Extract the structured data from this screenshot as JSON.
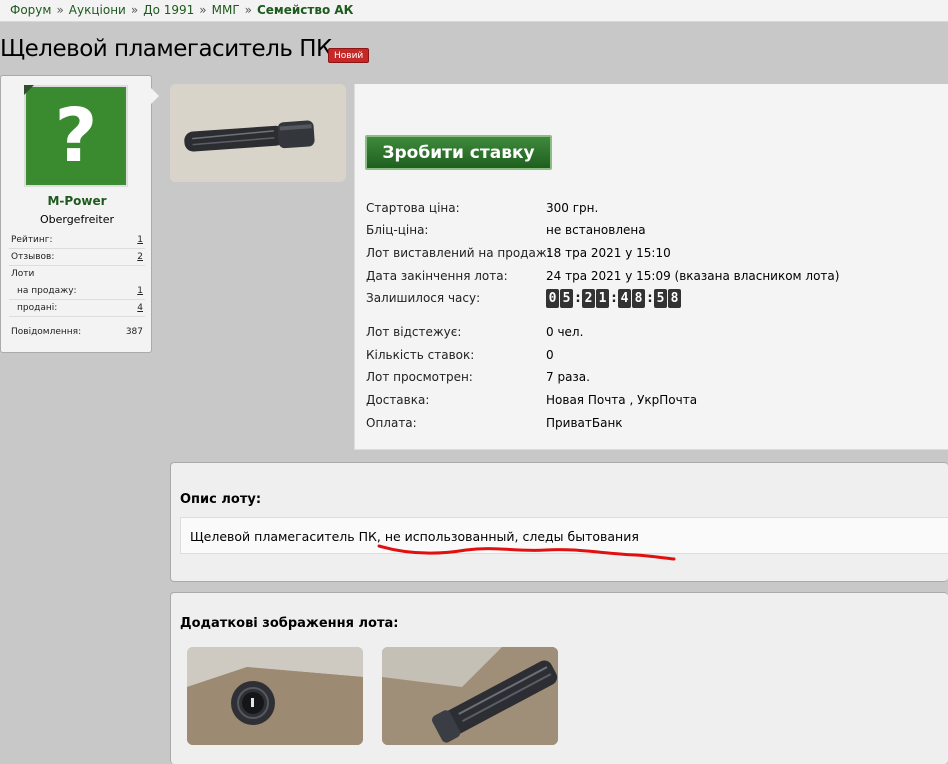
{
  "breadcrumb": {
    "items": [
      "Форум",
      "Аукціони",
      "До 1991",
      "ММГ"
    ],
    "separator": "»",
    "current": "Семейство АК"
  },
  "page": {
    "title": "Щелевой пламегаситель ПК",
    "badge": "Новий"
  },
  "user": {
    "avatar_icon": "question-mark-icon",
    "avatar_glyph": "?",
    "name": "M-Power",
    "rank": "Obergefreiter",
    "stats": {
      "rating_label": "Рейтинг:",
      "rating_value": "1",
      "reviews_label": "Отзывов:",
      "reviews_value": "2",
      "lots_label": "Лоти",
      "for_sale_label": "на продажу:",
      "for_sale_value": "1",
      "sold_label": "продані:",
      "sold_value": "4",
      "messages_label": "Повідомлення:",
      "messages_value": "387"
    }
  },
  "lot": {
    "bid_button": "Зробити ставку",
    "rows": [
      {
        "label": "Стартова ціна:",
        "value": "300 грн."
      },
      {
        "label": "Бліц-ціна:",
        "value": "не встановлена"
      },
      {
        "label": "Лот виставлений на продаж:",
        "value": "18 тра 2021 у 15:10"
      },
      {
        "label": "Дата закінчення лота:",
        "value": "24 тра 2021 у 15:09 (вказана власником лота)"
      },
      {
        "label": "Залишилося часу:",
        "value": ""
      },
      {
        "label": "Лот відстежує:",
        "value": "0 чел."
      },
      {
        "label": "Кількість ставок:",
        "value": "0"
      },
      {
        "label": "Лот просмотрен:",
        "value": "7 раза."
      },
      {
        "label": "Доставка:",
        "value": "Новая Почта , УкрПочта"
      },
      {
        "label": "Оплата:",
        "value": "ПриватБанк"
      }
    ],
    "timer": [
      "0",
      "5",
      ":",
      "2",
      "1",
      ":",
      "4",
      "8",
      ":",
      "5",
      "8"
    ]
  },
  "description": {
    "heading": "Опис лоту:",
    "text": "Щелевой пламегаситель ПК, не использованный, следы бытования"
  },
  "images": {
    "heading": "Додаткові зображення лота:"
  },
  "colors": {
    "accent_green": "#1e5a1e",
    "badge_red": "#c62828",
    "underline_red": "#e01010"
  }
}
